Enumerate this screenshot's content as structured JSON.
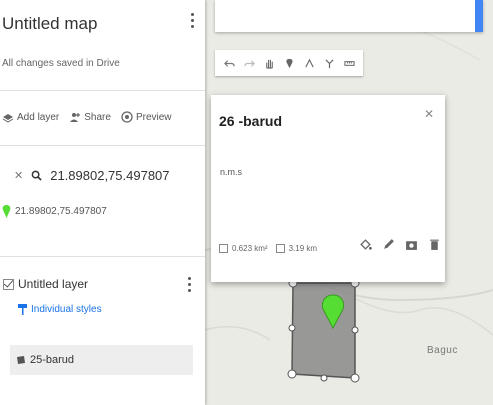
{
  "panel": {
    "title": "Untitled map",
    "subtitle": "All changes saved in Drive",
    "actions": [
      {
        "label": "Add layer",
        "icon": "add-layer-icon"
      },
      {
        "label": "Share",
        "icon": "person-add-icon"
      },
      {
        "label": "Preview",
        "icon": "eye-icon"
      }
    ],
    "search": {
      "value": "21.89802,75.497807"
    },
    "result": {
      "label": "21.89802,75.497807",
      "icon": "map-pin-icon"
    },
    "layer": {
      "name": "Untitled layer",
      "styles_label": "Individual styles",
      "feature": "25-barud"
    }
  },
  "toolbar": {
    "tools": [
      "undo-icon",
      "redo-icon",
      "hand-icon",
      "add-marker-icon",
      "draw-line-icon",
      "route-icon",
      "ruler-icon"
    ]
  },
  "card": {
    "title": "26 -barud",
    "description": "n.m.s",
    "area": "0.623 km²",
    "length": "3.19 km",
    "tools": [
      "paint-bucket-icon",
      "pencil-icon",
      "camera-icon",
      "trash-icon"
    ]
  },
  "map": {
    "place_label": "Baguc"
  },
  "colors": {
    "accent_blue": "#4285f4",
    "marker_green": "#55dd33",
    "polygon_fill": "#8a8a8a",
    "map_bg": "#e9ebe4"
  }
}
